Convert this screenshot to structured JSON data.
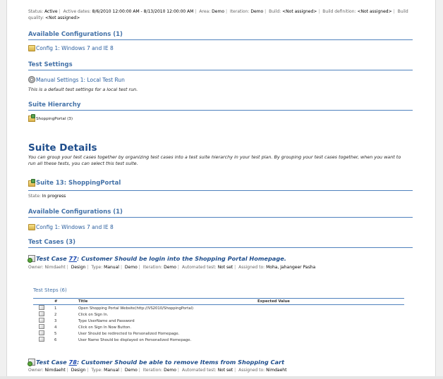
{
  "status_line": {
    "status_label": "Status:",
    "status": "Active",
    "active_dates_label": "Active dates:",
    "active_dates": "8/6/2010 12:00:00 AM - 8/13/2010 12:00:00 AM",
    "area_label": "Area:",
    "area": "Demo",
    "iteration_label": "Iteration:",
    "iteration": "Demo",
    "build_label": "Build:",
    "build": "<Not assigned>",
    "build_definition_label": "Build definition:",
    "build_definition": "<Not assigned>",
    "build_quality_label": "Build quality:",
    "build_quality": "<Not assigned>"
  },
  "plan": {
    "configs_heading": "Available Configurations (1)",
    "config_link": "Config 1: Windows 7 and IE 8",
    "settings_heading": "Test Settings",
    "settings_link": "Manual Settings 1: Local Test Run",
    "settings_desc": "This is a default test settings for a local test run.",
    "hierarchy_heading": "Suite Hierarchy",
    "hierarchy_item": "ShoppingPortal (3)"
  },
  "suite_details": {
    "title": "Suite Details",
    "desc": "You can group your test cases together by organizing test cases into a test suite hierarchy in your test plan. By grouping your test cases together, when you want to run all these tests, you can select this test suite.",
    "suite_heading": "Suite 13: ShoppingPortal",
    "state_label": "State:",
    "state": "In progress",
    "configs_heading": "Available Configurations (1)",
    "config_link": "Config 1: Windows 7 and IE 8",
    "test_cases_heading": "Test Cases (3)"
  },
  "test_case_77": {
    "prefix": "Test Case",
    "num": "77",
    "title": ": Customer Should be login into the Shopping Portal Homepage.",
    "owner_label": "Owner:",
    "owner": "Nimdaeht",
    "area": "Design",
    "type_label": "Type:",
    "type": "Manual",
    "area2": "Demo",
    "iteration_label": "Iteration:",
    "iteration": "Demo",
    "automated_label": "Automated test:",
    "automated": "Not set",
    "assigned_label": "Assigned to:",
    "assigned": "Moha, Jahangeer Pasha",
    "steps_heading": "Test Steps (6)",
    "col_num": "#",
    "col_title": "Title",
    "col_expected": "Expected Value",
    "steps": [
      {
        "n": "1",
        "title": "Open Shopping Portal Website(http://VS2010/ShoppingPortal)"
      },
      {
        "n": "2",
        "title": "Click on Sign In."
      },
      {
        "n": "3",
        "title": "Type UserName and Password"
      },
      {
        "n": "4",
        "title": "Click on Sign In Now Button."
      },
      {
        "n": "5",
        "title": "User Should be redirected to Personalized Homepage."
      },
      {
        "n": "6",
        "title": "User Name Should be displayed on Personalized Homepage."
      }
    ]
  },
  "test_case_78": {
    "prefix": "Test Case",
    "num": "78",
    "title": ": Customer Should be able to remove Items from Shopping Cart",
    "owner_label": "Owner:",
    "owner": "Nimdaeht",
    "area": "Design",
    "type_label": "Type:",
    "type": "Manual",
    "area2": "Demo",
    "iteration_label": "Iteration:",
    "iteration": "Demo",
    "automated_label": "Automated test:",
    "automated": "Not set",
    "assigned_label": "Assigned to:",
    "assigned": "Nimdaeht"
  }
}
